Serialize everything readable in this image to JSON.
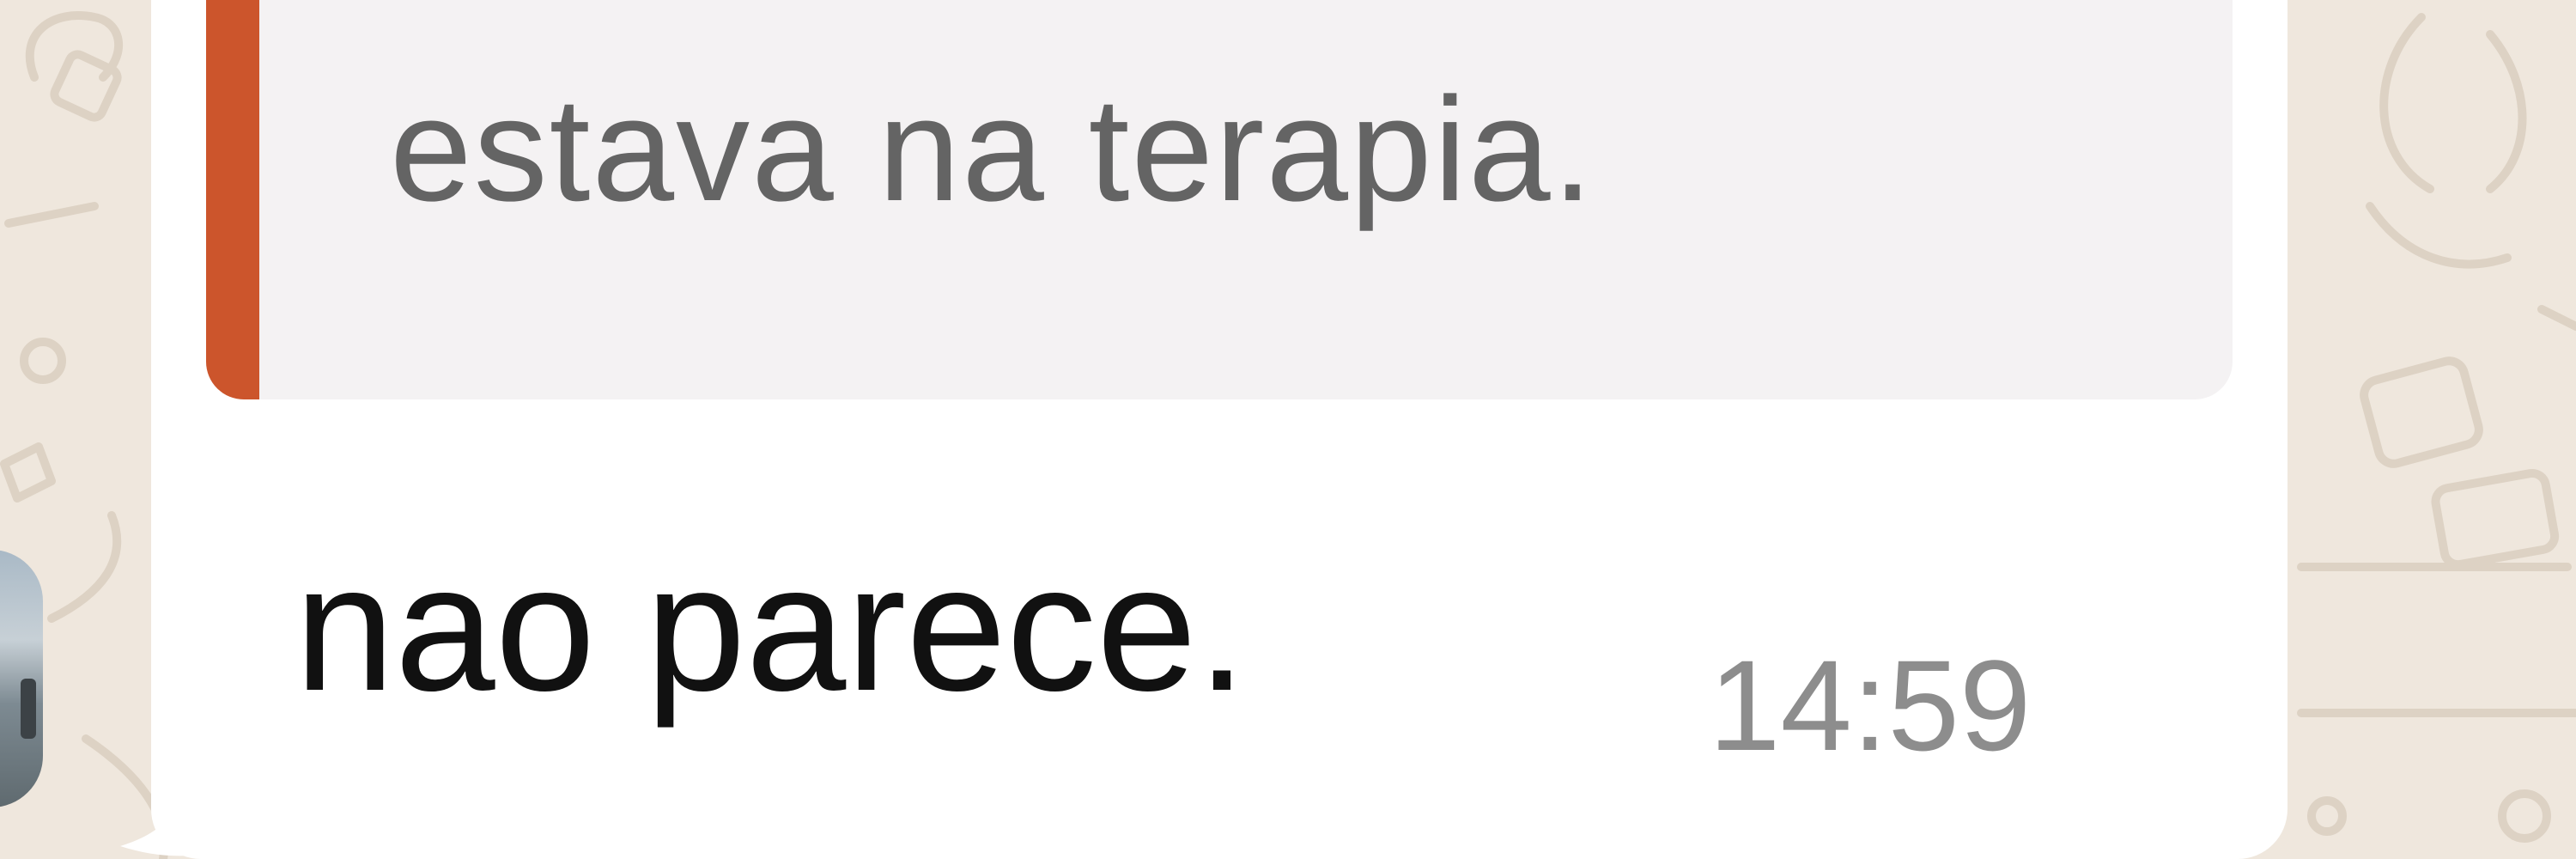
{
  "conversation": {
    "quoted_reply": {
      "text": "estava na terapia.",
      "accent_color": "#cc552c"
    },
    "message": {
      "text": "nao parece.",
      "time": "14:59"
    }
  },
  "theme": {
    "chat_background": "#efe7dd",
    "bubble_background": "#ffffff",
    "quote_background": "#f4f2f3"
  },
  "icons": [
    "contact-avatar"
  ]
}
